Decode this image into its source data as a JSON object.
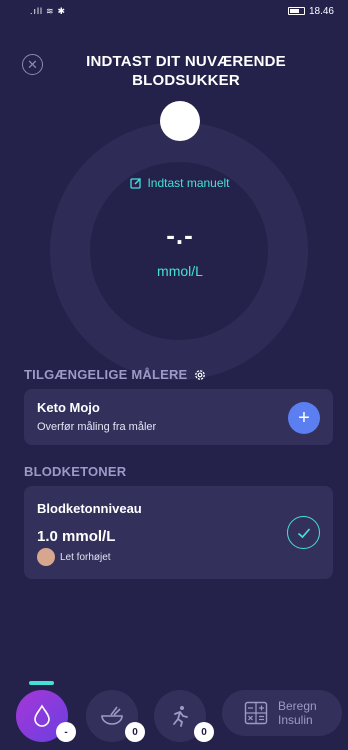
{
  "status_bar": {
    "signal": ".ıll",
    "wifi": "≋",
    "bluetooth": "✱",
    "time": "18.46"
  },
  "header": {
    "title": "INDTAST DIT NUVÆRENDE BLODSUKKER"
  },
  "dial": {
    "manual_entry_label": "Indtast manuelt",
    "reading": "-.-",
    "unit": "mmol/L"
  },
  "meters_section": {
    "title": "TILGÆNGELIGE MÅLERE",
    "card": {
      "name": "Keto Mojo",
      "description": "Overfør måling fra måler",
      "add_symbol": "+"
    }
  },
  "ketones_section": {
    "title": "BLODKETONER",
    "card": {
      "name": "Blodketonniveau",
      "value": "1.0 mmol/L",
      "level_label": "Let forhøjet"
    }
  },
  "bottom_nav": {
    "glucose_badge": "-",
    "food_badge": "0",
    "activity_badge": "0",
    "calc_label": "Beregn Insulin"
  },
  "colors": {
    "background": "#24224a",
    "card": "#33315c",
    "accent": "#46e0d8",
    "add_button": "#5b7ff0",
    "level_dot": "#d7a68f"
  }
}
